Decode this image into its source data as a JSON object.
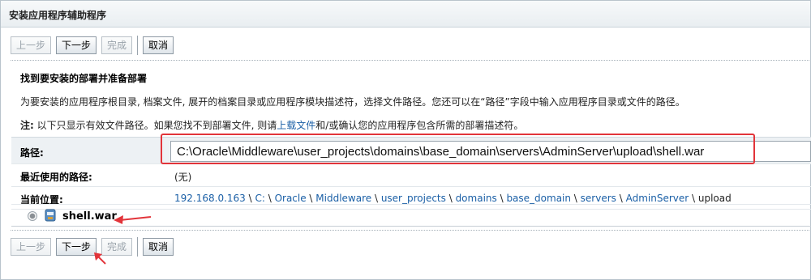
{
  "window": {
    "title": "安装应用程序辅助程序"
  },
  "toolbar": {
    "back_label": "上一步",
    "next_label": "下一步",
    "finish_label": "完成",
    "cancel_label": "取消"
  },
  "section": {
    "heading": "找到要安装的部署并准备部署",
    "description": "为要安装的应用程序根目录, 档案文件, 展开的档案目录或应用程序模块描述符，选择文件路径。您还可以在“路径”字段中输入应用程序目录或文件的路径。",
    "note_label": "注:",
    "note_text_before": " 以下只显示有效文件路径。如果您找不到部署文件, 则请",
    "note_link": "上载文件",
    "note_text_after": "和/或确认您的应用程序包含所需的部署描述符。"
  },
  "form": {
    "path_label": "路径:",
    "path_value": "C:\\Oracle\\Middleware\\user_projects\\domains\\base_domain\\servers\\AdminServer\\upload\\shell.war",
    "recent_label": "最近使用的路径:",
    "recent_value": "(无)",
    "current_label": "当前位置:",
    "breadcrumb": {
      "items": [
        "192.168.0.163",
        "C:",
        "Oracle",
        "Middleware",
        "user_projects",
        "domains",
        "base_domain",
        "servers",
        "AdminServer"
      ],
      "separator": " \\ ",
      "last": "upload"
    }
  },
  "files": [
    {
      "name": "shell.war",
      "selected": true
    }
  ],
  "colors": {
    "link": "#1a5fa6",
    "highlight": "#e2343a"
  }
}
